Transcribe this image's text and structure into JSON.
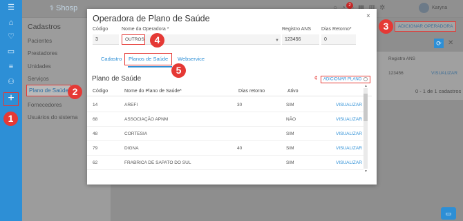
{
  "app": {
    "logo_text": "Shosp",
    "user_name": "Karyna",
    "notification_count": "2"
  },
  "sidebar": {
    "section_title": "Cadastros",
    "items": [
      {
        "label": "Pacientes"
      },
      {
        "label": "Prestadores"
      },
      {
        "label": "Unidades"
      },
      {
        "label": "Serviços"
      },
      {
        "label": "Plano de Saúde"
      },
      {
        "label": "Fornecedores"
      },
      {
        "label": "Usuários do sistema"
      }
    ]
  },
  "main": {
    "add_operator_label": "ADICIONAR OPERADORA",
    "col_registro": "Registro ANS",
    "row_registro": "123456",
    "row_action": "VISUALIZAR",
    "pagination": "0 - 1 de 1 cadastros"
  },
  "modal": {
    "title": "Operadora de Plano de Saúde",
    "fields": {
      "codigo_label": "Código",
      "codigo_value": "3",
      "nome_label": "Nome da Operadora *",
      "nome_value": "OUTROS",
      "registro_label": "Registro ANS",
      "registro_value": "123456",
      "dias_label": "Dias Retorno*",
      "dias_value": "0"
    },
    "tabs": [
      {
        "label": "Cadastro"
      },
      {
        "label": "Planos de Saúde"
      },
      {
        "label": "Webservice"
      }
    ],
    "plans": {
      "title": "Plano de Saúde",
      "required_mark": "¢",
      "add_label": "ADICIONAR PLANO",
      "columns": [
        "Código",
        "Nome do Plano de Saúde*",
        "Dias retorno",
        "Ativo"
      ],
      "rows": [
        {
          "codigo": "14",
          "nome": "AREFI",
          "dias": "30",
          "ativo": "SIM",
          "action": "VISUALIZAR"
        },
        {
          "codigo": "68",
          "nome": "ASSOCIAÇÃO APNM",
          "dias": "",
          "ativo": "NÃO",
          "action": "VISUALIZAR"
        },
        {
          "codigo": "48",
          "nome": "CORTESIA",
          "dias": "",
          "ativo": "SIM",
          "action": "VISUALIZAR"
        },
        {
          "codigo": "79",
          "nome": "DIGNA",
          "dias": "40",
          "ativo": "SIM",
          "action": "VISUALIZAR"
        },
        {
          "codigo": "62",
          "nome": "FRABRICA DE SAPATO DO SUL",
          "dias": "",
          "ativo": "SIM",
          "action": "VISUALIZAR"
        }
      ]
    }
  },
  "callouts": [
    "1",
    "2",
    "3",
    "4",
    "5"
  ],
  "icons": {
    "rail": [
      "menu-icon",
      "home-icon",
      "heart-icon",
      "money-icon",
      "database-icon",
      "users-icon",
      "plus-icon"
    ],
    "header": [
      "search-icon",
      "bell-icon",
      "chat-icon",
      "grid-icon",
      "chart-icon",
      "gear-icon"
    ]
  },
  "colors": {
    "accent": "#2d8fd6",
    "highlight": "#e53935"
  }
}
